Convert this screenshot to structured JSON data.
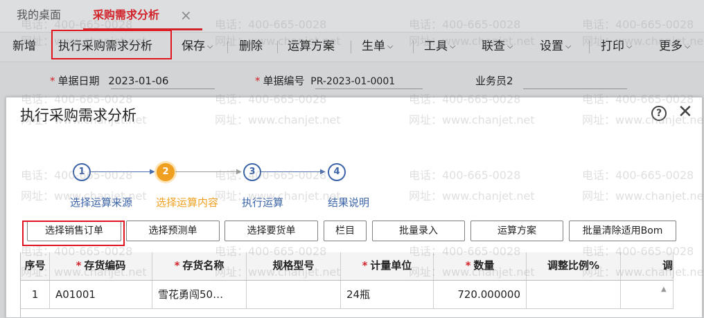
{
  "tabs": {
    "home_label": "我的桌面",
    "active_label": "采购需求分析",
    "close_glyph": "×"
  },
  "toolbar": {
    "items": [
      {
        "label": "新增",
        "dropdown": false
      },
      {
        "label": "执行采购需求分析",
        "dropdown": false
      },
      {
        "label": "保存",
        "dropdown": true
      },
      {
        "label": "删除",
        "dropdown": false
      },
      {
        "label": "运算方案",
        "dropdown": false
      },
      {
        "label": "生单",
        "dropdown": true
      },
      {
        "label": "工具",
        "dropdown": true
      },
      {
        "label": "联查",
        "dropdown": true
      },
      {
        "label": "设置",
        "dropdown": true
      },
      {
        "label": "打印",
        "dropdown": true
      },
      {
        "label": "更多",
        "dropdown": true
      }
    ]
  },
  "form": {
    "date_label": "单据日期",
    "date_value": "2023-01-06",
    "code_label": "单据编号",
    "code_value": "PR-2023-01-0001",
    "salesman_label": "业务员2",
    "required_mark": "*"
  },
  "watermark": {
    "phone": "电话：400-665-0028",
    "site": "网址：www.chanjet.net"
  },
  "modal": {
    "title": "执行采购需求分析",
    "help_glyph": "?",
    "close_glyph": "✕",
    "steps": [
      {
        "number": "1",
        "label": "选择运算来源",
        "state": "done"
      },
      {
        "number": "2",
        "label": "选择运算内容",
        "state": "current"
      },
      {
        "number": "3",
        "label": "执行运算",
        "state": "todo"
      },
      {
        "number": "4",
        "label": "结果说明",
        "state": "todo"
      }
    ],
    "buttons": [
      {
        "label": "选择销售订单"
      },
      {
        "label": "选择预测单"
      },
      {
        "label": "选择要货单"
      },
      {
        "label": "栏目"
      },
      {
        "label": "批量录入"
      },
      {
        "label": "运算方案"
      },
      {
        "label": "批量清除适用Bom"
      }
    ],
    "table": {
      "columns": [
        {
          "label": "序号",
          "required": false
        },
        {
          "label": "存货编码",
          "required": true
        },
        {
          "label": "存货名称",
          "required": true
        },
        {
          "label": "规格型号",
          "required": false
        },
        {
          "label": "计量单位",
          "required": true
        },
        {
          "label": "数量",
          "required": true
        },
        {
          "label": "调整比例%",
          "required": false
        },
        {
          "label": "调",
          "required": false
        }
      ],
      "rows": [
        [
          "1",
          "A01001",
          "雪花勇闯50…",
          "",
          "24瓶",
          "720.000000",
          "",
          ""
        ]
      ]
    },
    "colors": {
      "accent_red": "#d2232a",
      "step_blue": "#3a63a8",
      "step_orange": "#f0a020"
    }
  }
}
